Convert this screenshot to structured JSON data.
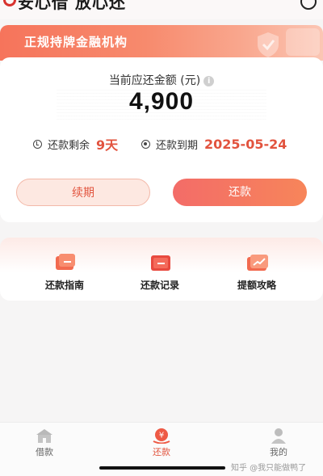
{
  "header": {
    "slogan": "安心借 放心还"
  },
  "banner": {
    "text": "正规持牌金融机构"
  },
  "repayment": {
    "amount_label": "当前应还金额 (元)",
    "amount": "4,900",
    "remaining_label": "还款剩余",
    "remaining_value": "9天",
    "due_label": "还款到期",
    "due_value": "2025-05-24",
    "renew_button": "续期",
    "repay_button": "还款"
  },
  "menu": {
    "items": [
      {
        "label": "还款指南",
        "icon": "guide-icon"
      },
      {
        "label": "还款记录",
        "icon": "record-icon"
      },
      {
        "label": "提额攻略",
        "icon": "limit-up-icon"
      }
    ]
  },
  "nav": {
    "items": [
      {
        "label": "借款",
        "icon": "home-icon",
        "active": false
      },
      {
        "label": "还款",
        "icon": "yuan-icon",
        "active": true
      },
      {
        "label": "我的",
        "icon": "user-icon",
        "active": false
      }
    ]
  },
  "watermark": "知乎 @我只能做鸭了",
  "colors": {
    "accent": "#e2553f",
    "banner_start": "#f6745b",
    "banner_end": "#fbc6b4"
  }
}
